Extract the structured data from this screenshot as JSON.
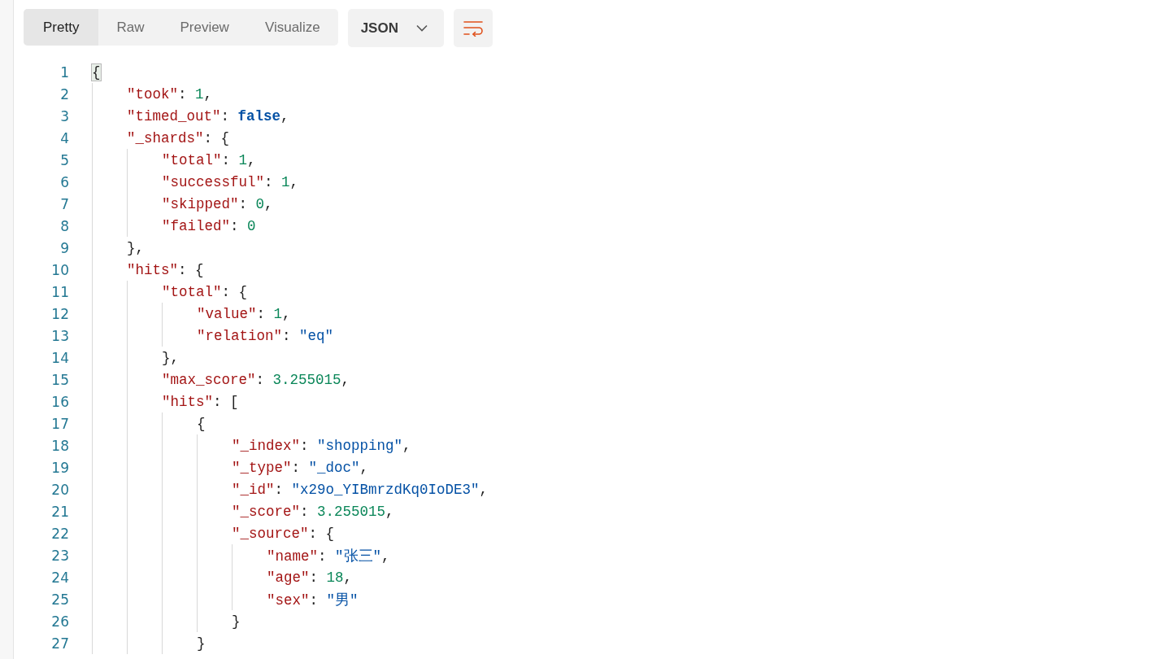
{
  "view_tabs": [
    {
      "label": "Pretty",
      "selected": true
    },
    {
      "label": "Raw",
      "selected": false
    },
    {
      "label": "Preview",
      "selected": false
    },
    {
      "label": "Visualize",
      "selected": false
    }
  ],
  "format_dropdown": {
    "value": "JSON"
  },
  "code_lines": [
    {
      "number": "1",
      "tokens": [
        {
          "kind": "matched-bracket",
          "text": "{"
        }
      ],
      "children": [
        {
          "number": "2",
          "tokens": [
            {
              "kind": "key",
              "text": "\"took\""
            },
            {
              "kind": "punct",
              "text": ": "
            },
            {
              "kind": "number",
              "text": "1"
            },
            {
              "kind": "punct",
              "text": ","
            }
          ]
        },
        {
          "number": "3",
          "tokens": [
            {
              "kind": "key",
              "text": "\"timed_out\""
            },
            {
              "kind": "punct",
              "text": ": "
            },
            {
              "kind": "keyword",
              "text": "false"
            },
            {
              "kind": "punct",
              "text": ","
            }
          ]
        },
        {
          "number": "4",
          "tokens": [
            {
              "kind": "key",
              "text": "\"_shards\""
            },
            {
              "kind": "punct",
              "text": ": {"
            }
          ],
          "children": [
            {
              "number": "5",
              "tokens": [
                {
                  "kind": "key",
                  "text": "\"total\""
                },
                {
                  "kind": "punct",
                  "text": ": "
                },
                {
                  "kind": "number",
                  "text": "1"
                },
                {
                  "kind": "punct",
                  "text": ","
                }
              ]
            },
            {
              "number": "6",
              "tokens": [
                {
                  "kind": "key",
                  "text": "\"successful\""
                },
                {
                  "kind": "punct",
                  "text": ": "
                },
                {
                  "kind": "number",
                  "text": "1"
                },
                {
                  "kind": "punct",
                  "text": ","
                }
              ]
            },
            {
              "number": "7",
              "tokens": [
                {
                  "kind": "key",
                  "text": "\"skipped\""
                },
                {
                  "kind": "punct",
                  "text": ": "
                },
                {
                  "kind": "number",
                  "text": "0"
                },
                {
                  "kind": "punct",
                  "text": ","
                }
              ]
            },
            {
              "number": "8",
              "tokens": [
                {
                  "kind": "key",
                  "text": "\"failed\""
                },
                {
                  "kind": "punct",
                  "text": ": "
                },
                {
                  "kind": "number",
                  "text": "0"
                }
              ]
            }
          ]
        },
        {
          "number": "9",
          "tokens": [
            {
              "kind": "punct",
              "text": "},"
            }
          ]
        },
        {
          "number": "10",
          "tokens": [
            {
              "kind": "key",
              "text": "\"hits\""
            },
            {
              "kind": "punct",
              "text": ": {"
            }
          ],
          "children": [
            {
              "number": "11",
              "tokens": [
                {
                  "kind": "key",
                  "text": "\"total\""
                },
                {
                  "kind": "punct",
                  "text": ": {"
                }
              ],
              "children": [
                {
                  "number": "12",
                  "tokens": [
                    {
                      "kind": "key",
                      "text": "\"value\""
                    },
                    {
                      "kind": "punct",
                      "text": ": "
                    },
                    {
                      "kind": "number",
                      "text": "1"
                    },
                    {
                      "kind": "punct",
                      "text": ","
                    }
                  ]
                },
                {
                  "number": "13",
                  "tokens": [
                    {
                      "kind": "key",
                      "text": "\"relation\""
                    },
                    {
                      "kind": "punct",
                      "text": ": "
                    },
                    {
                      "kind": "string",
                      "text": "\"eq\""
                    }
                  ]
                }
              ]
            },
            {
              "number": "14",
              "tokens": [
                {
                  "kind": "punct",
                  "text": "},"
                }
              ]
            },
            {
              "number": "15",
              "tokens": [
                {
                  "kind": "key",
                  "text": "\"max_score\""
                },
                {
                  "kind": "punct",
                  "text": ": "
                },
                {
                  "kind": "number",
                  "text": "3.255015"
                },
                {
                  "kind": "punct",
                  "text": ","
                }
              ]
            },
            {
              "number": "16",
              "tokens": [
                {
                  "kind": "key",
                  "text": "\"hits\""
                },
                {
                  "kind": "punct",
                  "text": ": ["
                }
              ],
              "children": [
                {
                  "number": "17",
                  "tokens": [
                    {
                      "kind": "punct",
                      "text": "{"
                    }
                  ],
                  "children": [
                    {
                      "number": "18",
                      "tokens": [
                        {
                          "kind": "key",
                          "text": "\"_index\""
                        },
                        {
                          "kind": "punct",
                          "text": ": "
                        },
                        {
                          "kind": "string",
                          "text": "\"shopping\""
                        },
                        {
                          "kind": "punct",
                          "text": ","
                        }
                      ]
                    },
                    {
                      "number": "19",
                      "tokens": [
                        {
                          "kind": "key",
                          "text": "\"_type\""
                        },
                        {
                          "kind": "punct",
                          "text": ": "
                        },
                        {
                          "kind": "string",
                          "text": "\"_doc\""
                        },
                        {
                          "kind": "punct",
                          "text": ","
                        }
                      ]
                    },
                    {
                      "number": "20",
                      "tokens": [
                        {
                          "kind": "key",
                          "text": "\"_id\""
                        },
                        {
                          "kind": "punct",
                          "text": ": "
                        },
                        {
                          "kind": "string",
                          "text": "\"x29o_YIBmrzdKq0IoDE3\""
                        },
                        {
                          "kind": "punct",
                          "text": ","
                        }
                      ]
                    },
                    {
                      "number": "21",
                      "tokens": [
                        {
                          "kind": "key",
                          "text": "\"_score\""
                        },
                        {
                          "kind": "punct",
                          "text": ": "
                        },
                        {
                          "kind": "number",
                          "text": "3.255015"
                        },
                        {
                          "kind": "punct",
                          "text": ","
                        }
                      ]
                    },
                    {
                      "number": "22",
                      "tokens": [
                        {
                          "kind": "key",
                          "text": "\"_source\""
                        },
                        {
                          "kind": "punct",
                          "text": ": {"
                        }
                      ],
                      "children": [
                        {
                          "number": "23",
                          "tokens": [
                            {
                              "kind": "key",
                              "text": "\"name\""
                            },
                            {
                              "kind": "punct",
                              "text": ": "
                            },
                            {
                              "kind": "string",
                              "text": "\"张三\""
                            },
                            {
                              "kind": "punct",
                              "text": ","
                            }
                          ]
                        },
                        {
                          "number": "24",
                          "tokens": [
                            {
                              "kind": "key",
                              "text": "\"age\""
                            },
                            {
                              "kind": "punct",
                              "text": ": "
                            },
                            {
                              "kind": "number",
                              "text": "18"
                            },
                            {
                              "kind": "punct",
                              "text": ","
                            }
                          ]
                        },
                        {
                          "number": "25",
                          "tokens": [
                            {
                              "kind": "key",
                              "text": "\"sex\""
                            },
                            {
                              "kind": "punct",
                              "text": ": "
                            },
                            {
                              "kind": "string",
                              "text": "\"男\""
                            }
                          ]
                        }
                      ]
                    },
                    {
                      "number": "26",
                      "tokens": [
                        {
                          "kind": "punct",
                          "text": "}"
                        }
                      ]
                    }
                  ]
                },
                {
                  "number": "27",
                  "tokens": [
                    {
                      "kind": "punct",
                      "text": "}"
                    }
                  ]
                }
              ]
            }
          ]
        }
      ]
    }
  ]
}
